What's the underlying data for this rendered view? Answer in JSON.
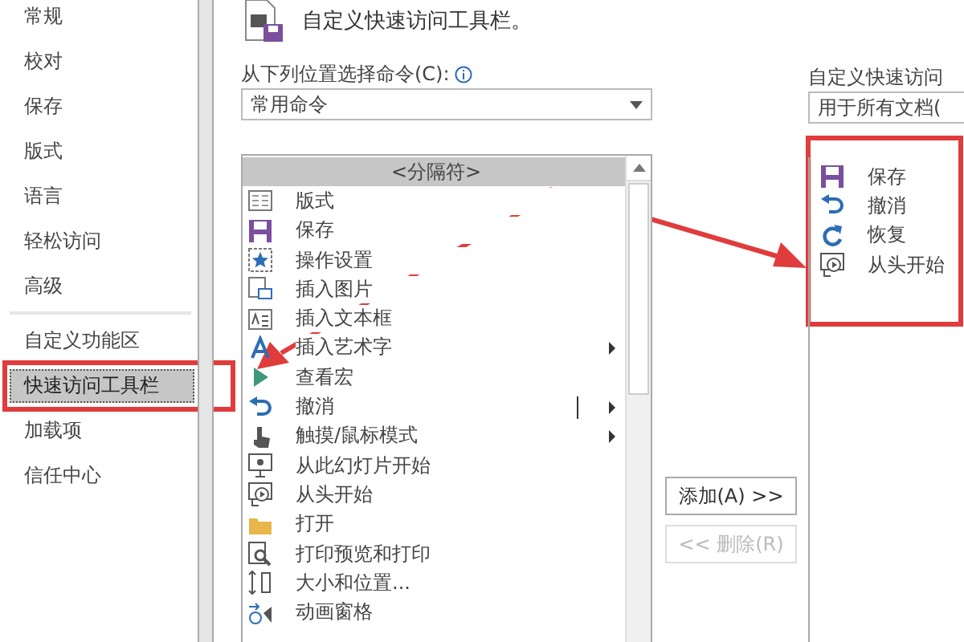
{
  "sidebar": {
    "items": [
      {
        "label": "常规",
        "selected": false
      },
      {
        "label": "校对",
        "selected": false
      },
      {
        "label": "保存",
        "selected": false
      },
      {
        "label": "版式",
        "selected": false
      },
      {
        "label": "语言",
        "selected": false
      },
      {
        "label": "轻松访问",
        "selected": false
      },
      {
        "label": "高级",
        "selected": false
      },
      {
        "label": "自定义功能区",
        "selected": false,
        "divider_before": true
      },
      {
        "label": "快速访问工具栏",
        "selected": true
      },
      {
        "label": "加载项",
        "selected": false
      },
      {
        "label": "信任中心",
        "selected": false
      }
    ]
  },
  "heading": "自定义快速访问工具栏。",
  "commands": {
    "label": "从下列位置选择命令(C):",
    "dropdown": "常用命令",
    "items": [
      {
        "label": "<分隔符>",
        "selected": true,
        "submenu": false
      },
      {
        "label": "版式",
        "selected": false,
        "submenu": false
      },
      {
        "label": "保存",
        "selected": false,
        "submenu": false
      },
      {
        "label": "操作设置",
        "selected": false,
        "submenu": false
      },
      {
        "label": "插入图片",
        "selected": false,
        "submenu": false
      },
      {
        "label": "插入文本框",
        "selected": false,
        "submenu": false
      },
      {
        "label": "插入艺术字",
        "selected": false,
        "submenu": true
      },
      {
        "label": "查看宏",
        "selected": false,
        "submenu": false
      },
      {
        "label": "撤消",
        "selected": false,
        "submenu": true,
        "split": true
      },
      {
        "label": "触摸/鼠标模式",
        "selected": false,
        "submenu": true
      },
      {
        "label": "从此幻灯片开始",
        "selected": false,
        "submenu": false
      },
      {
        "label": "从头开始",
        "selected": false,
        "submenu": false
      },
      {
        "label": "打开",
        "selected": false,
        "submenu": false
      },
      {
        "label": "打印预览和打印",
        "selected": false,
        "submenu": false
      },
      {
        "label": "大小和位置...",
        "selected": false,
        "submenu": false
      },
      {
        "label": "动画窗格",
        "selected": false,
        "submenu": false
      }
    ]
  },
  "buttons": [
    {
      "label": "添加(A) >>",
      "disabled": false
    },
    {
      "label": "<< 删除(R)",
      "disabled": true
    }
  ],
  "toolbar": {
    "label": "自定义快速访问",
    "dropdown": "用于所有文档(",
    "items": [
      {
        "label": "保存"
      },
      {
        "label": "撤消"
      },
      {
        "label": "恢复"
      },
      {
        "label": "从头开始"
      }
    ]
  }
}
